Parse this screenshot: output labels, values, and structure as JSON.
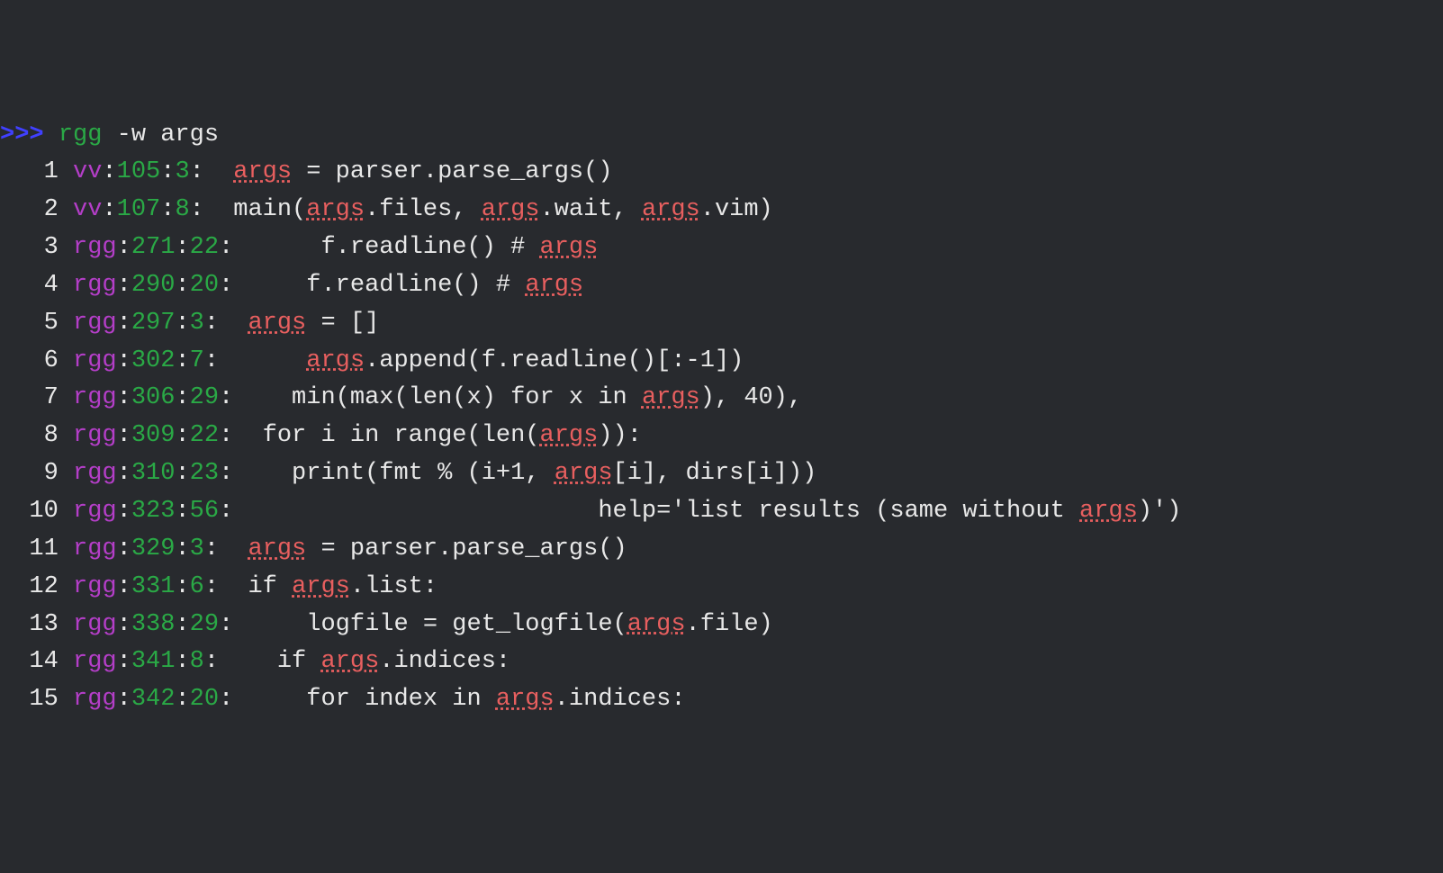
{
  "prompt": {
    "symbol": ">>> ",
    "command": "rgg",
    "args": " -w args"
  },
  "match_word": "args",
  "results": [
    {
      "n": "1",
      "file": "vv",
      "line": "105",
      "col": "3",
      "pre": " ",
      "segments": [
        {
          "t": "args",
          "m": true
        },
        {
          "t": " = parser.parse_args()",
          "m": false
        }
      ]
    },
    {
      "n": "2",
      "file": "vv",
      "line": "107",
      "col": "8",
      "pre": " ",
      "segments": [
        {
          "t": "main(",
          "m": false
        },
        {
          "t": "args",
          "m": true
        },
        {
          "t": ".files, ",
          "m": false
        },
        {
          "t": "args",
          "m": true
        },
        {
          "t": ".wait, ",
          "m": false
        },
        {
          "t": "args",
          "m": true
        },
        {
          "t": ".vim)",
          "m": false
        }
      ]
    },
    {
      "n": "3",
      "file": "rgg",
      "line": "271",
      "col": "22",
      "pre": "",
      "segments": [
        {
          "t": "     f.readline() # ",
          "m": false
        },
        {
          "t": "args",
          "m": true
        }
      ]
    },
    {
      "n": "4",
      "file": "rgg",
      "line": "290",
      "col": "20",
      "pre": "",
      "segments": [
        {
          "t": "    f.readline() # ",
          "m": false
        },
        {
          "t": "args",
          "m": true
        }
      ]
    },
    {
      "n": "5",
      "file": "rgg",
      "line": "297",
      "col": "3",
      "pre": " ",
      "segments": [
        {
          "t": "args",
          "m": true
        },
        {
          "t": " = []",
          "m": false
        }
      ]
    },
    {
      "n": "6",
      "file": "rgg",
      "line": "302",
      "col": "7",
      "pre": " ",
      "segments": [
        {
          "t": "    ",
          "m": false
        },
        {
          "t": "args",
          "m": true
        },
        {
          "t": ".append(f.readline()[:-1])",
          "m": false
        }
      ]
    },
    {
      "n": "7",
      "file": "rgg",
      "line": "306",
      "col": "29",
      "pre": "",
      "segments": [
        {
          "t": "   min(max(len(x) for x in ",
          "m": false
        },
        {
          "t": "args",
          "m": true
        },
        {
          "t": "), 40),",
          "m": false
        }
      ]
    },
    {
      "n": "8",
      "file": "rgg",
      "line": "309",
      "col": "22",
      "pre": "",
      "segments": [
        {
          "t": " for i in range(len(",
          "m": false
        },
        {
          "t": "args",
          "m": true
        },
        {
          "t": ")):",
          "m": false
        }
      ]
    },
    {
      "n": "9",
      "file": "rgg",
      "line": "310",
      "col": "23",
      "pre": "",
      "segments": [
        {
          "t": "   print(fmt % (i+1, ",
          "m": false
        },
        {
          "t": "args",
          "m": true
        },
        {
          "t": "[i], dirs[i]))",
          "m": false
        }
      ]
    },
    {
      "n": "10",
      "file": "rgg",
      "line": "323",
      "col": "56",
      "pre": "",
      "segments": [
        {
          "t": "                        help='list results (same without ",
          "m": false
        },
        {
          "t": "args",
          "m": true
        },
        {
          "t": ")')",
          "m": false
        }
      ]
    },
    {
      "n": "11",
      "file": "rgg",
      "line": "329",
      "col": "3",
      "pre": " ",
      "segments": [
        {
          "t": "args",
          "m": true
        },
        {
          "t": " = parser.parse_args()",
          "m": false
        }
      ]
    },
    {
      "n": "12",
      "file": "rgg",
      "line": "331",
      "col": "6",
      "pre": " ",
      "segments": [
        {
          "t": "if ",
          "m": false
        },
        {
          "t": "args",
          "m": true
        },
        {
          "t": ".list:",
          "m": false
        }
      ]
    },
    {
      "n": "13",
      "file": "rgg",
      "line": "338",
      "col": "29",
      "pre": "",
      "segments": [
        {
          "t": "    logfile = get_logfile(",
          "m": false
        },
        {
          "t": "args",
          "m": true
        },
        {
          "t": ".file)",
          "m": false
        }
      ]
    },
    {
      "n": "14",
      "file": "rgg",
      "line": "341",
      "col": "8",
      "pre": " ",
      "segments": [
        {
          "t": "  if ",
          "m": false
        },
        {
          "t": "args",
          "m": true
        },
        {
          "t": ".indices:",
          "m": false
        }
      ]
    },
    {
      "n": "15",
      "file": "rgg",
      "line": "342",
      "col": "20",
      "pre": "",
      "segments": [
        {
          "t": "    for index in ",
          "m": false
        },
        {
          "t": "args",
          "m": true
        },
        {
          "t": ".indices:",
          "m": false
        }
      ]
    }
  ]
}
